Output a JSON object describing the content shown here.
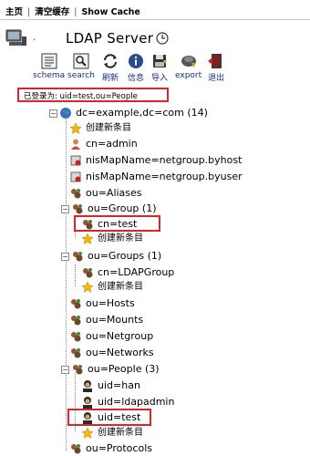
{
  "nav": {
    "home": "主页",
    "clear_cache": "清空缓存",
    "show_cache": "Show Cache"
  },
  "server": {
    "name": "LDAP Server"
  },
  "toolbar": {
    "schema": "schema",
    "search": "search",
    "refresh": "刷新",
    "info": "信息",
    "import": "导入",
    "export": "export",
    "logout": "退出"
  },
  "login": {
    "text": "已登录为: uid=test,ou=People"
  },
  "tree": {
    "root": "dc=example,dc=com (14)",
    "root_create": "创建新条目",
    "admin": "cn=admin",
    "byhost": "nisMapName=netgroup.byhost",
    "byuser": "nisMapName=netgroup.byuser",
    "aliases": "ou=Aliases",
    "group": "ou=Group (1)",
    "group_test": "cn=test",
    "group_create": "创建新条目",
    "groups": "ou=Groups (1)",
    "groups_ldapgroup": "cn=LDAPGroup",
    "groups_create": "创建新条目",
    "hosts": "ou=Hosts",
    "mounts": "ou=Mounts",
    "netgroup": "ou=Netgroup",
    "networks": "ou=Networks",
    "people": "ou=People (3)",
    "people_han": "uid=han",
    "people_ldapadmin": "uid=ldapadmin",
    "people_test": "uid=test",
    "people_create": "创建新条目",
    "protocols": "ou=Protocols"
  }
}
